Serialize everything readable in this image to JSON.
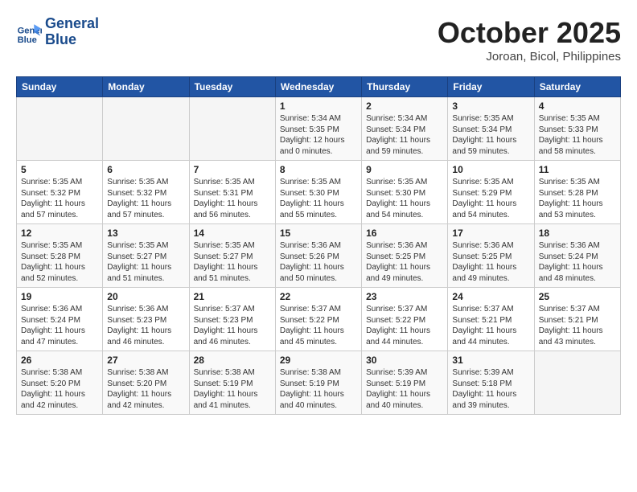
{
  "header": {
    "logo_line1": "General",
    "logo_line2": "Blue",
    "month": "October 2025",
    "location": "Joroan, Bicol, Philippines"
  },
  "weekdays": [
    "Sunday",
    "Monday",
    "Tuesday",
    "Wednesday",
    "Thursday",
    "Friday",
    "Saturday"
  ],
  "weeks": [
    [
      {
        "day": "",
        "info": ""
      },
      {
        "day": "",
        "info": ""
      },
      {
        "day": "",
        "info": ""
      },
      {
        "day": "1",
        "info": "Sunrise: 5:34 AM\nSunset: 5:35 PM\nDaylight: 12 hours\nand 0 minutes."
      },
      {
        "day": "2",
        "info": "Sunrise: 5:34 AM\nSunset: 5:34 PM\nDaylight: 11 hours\nand 59 minutes."
      },
      {
        "day": "3",
        "info": "Sunrise: 5:35 AM\nSunset: 5:34 PM\nDaylight: 11 hours\nand 59 minutes."
      },
      {
        "day": "4",
        "info": "Sunrise: 5:35 AM\nSunset: 5:33 PM\nDaylight: 11 hours\nand 58 minutes."
      }
    ],
    [
      {
        "day": "5",
        "info": "Sunrise: 5:35 AM\nSunset: 5:32 PM\nDaylight: 11 hours\nand 57 minutes."
      },
      {
        "day": "6",
        "info": "Sunrise: 5:35 AM\nSunset: 5:32 PM\nDaylight: 11 hours\nand 57 minutes."
      },
      {
        "day": "7",
        "info": "Sunrise: 5:35 AM\nSunset: 5:31 PM\nDaylight: 11 hours\nand 56 minutes."
      },
      {
        "day": "8",
        "info": "Sunrise: 5:35 AM\nSunset: 5:30 PM\nDaylight: 11 hours\nand 55 minutes."
      },
      {
        "day": "9",
        "info": "Sunrise: 5:35 AM\nSunset: 5:30 PM\nDaylight: 11 hours\nand 54 minutes."
      },
      {
        "day": "10",
        "info": "Sunrise: 5:35 AM\nSunset: 5:29 PM\nDaylight: 11 hours\nand 54 minutes."
      },
      {
        "day": "11",
        "info": "Sunrise: 5:35 AM\nSunset: 5:28 PM\nDaylight: 11 hours\nand 53 minutes."
      }
    ],
    [
      {
        "day": "12",
        "info": "Sunrise: 5:35 AM\nSunset: 5:28 PM\nDaylight: 11 hours\nand 52 minutes."
      },
      {
        "day": "13",
        "info": "Sunrise: 5:35 AM\nSunset: 5:27 PM\nDaylight: 11 hours\nand 51 minutes."
      },
      {
        "day": "14",
        "info": "Sunrise: 5:35 AM\nSunset: 5:27 PM\nDaylight: 11 hours\nand 51 minutes."
      },
      {
        "day": "15",
        "info": "Sunrise: 5:36 AM\nSunset: 5:26 PM\nDaylight: 11 hours\nand 50 minutes."
      },
      {
        "day": "16",
        "info": "Sunrise: 5:36 AM\nSunset: 5:25 PM\nDaylight: 11 hours\nand 49 minutes."
      },
      {
        "day": "17",
        "info": "Sunrise: 5:36 AM\nSunset: 5:25 PM\nDaylight: 11 hours\nand 49 minutes."
      },
      {
        "day": "18",
        "info": "Sunrise: 5:36 AM\nSunset: 5:24 PM\nDaylight: 11 hours\nand 48 minutes."
      }
    ],
    [
      {
        "day": "19",
        "info": "Sunrise: 5:36 AM\nSunset: 5:24 PM\nDaylight: 11 hours\nand 47 minutes."
      },
      {
        "day": "20",
        "info": "Sunrise: 5:36 AM\nSunset: 5:23 PM\nDaylight: 11 hours\nand 46 minutes."
      },
      {
        "day": "21",
        "info": "Sunrise: 5:37 AM\nSunset: 5:23 PM\nDaylight: 11 hours\nand 46 minutes."
      },
      {
        "day": "22",
        "info": "Sunrise: 5:37 AM\nSunset: 5:22 PM\nDaylight: 11 hours\nand 45 minutes."
      },
      {
        "day": "23",
        "info": "Sunrise: 5:37 AM\nSunset: 5:22 PM\nDaylight: 11 hours\nand 44 minutes."
      },
      {
        "day": "24",
        "info": "Sunrise: 5:37 AM\nSunset: 5:21 PM\nDaylight: 11 hours\nand 44 minutes."
      },
      {
        "day": "25",
        "info": "Sunrise: 5:37 AM\nSunset: 5:21 PM\nDaylight: 11 hours\nand 43 minutes."
      }
    ],
    [
      {
        "day": "26",
        "info": "Sunrise: 5:38 AM\nSunset: 5:20 PM\nDaylight: 11 hours\nand 42 minutes."
      },
      {
        "day": "27",
        "info": "Sunrise: 5:38 AM\nSunset: 5:20 PM\nDaylight: 11 hours\nand 42 minutes."
      },
      {
        "day": "28",
        "info": "Sunrise: 5:38 AM\nSunset: 5:19 PM\nDaylight: 11 hours\nand 41 minutes."
      },
      {
        "day": "29",
        "info": "Sunrise: 5:38 AM\nSunset: 5:19 PM\nDaylight: 11 hours\nand 40 minutes."
      },
      {
        "day": "30",
        "info": "Sunrise: 5:39 AM\nSunset: 5:19 PM\nDaylight: 11 hours\nand 40 minutes."
      },
      {
        "day": "31",
        "info": "Sunrise: 5:39 AM\nSunset: 5:18 PM\nDaylight: 11 hours\nand 39 minutes."
      },
      {
        "day": "",
        "info": ""
      }
    ]
  ]
}
